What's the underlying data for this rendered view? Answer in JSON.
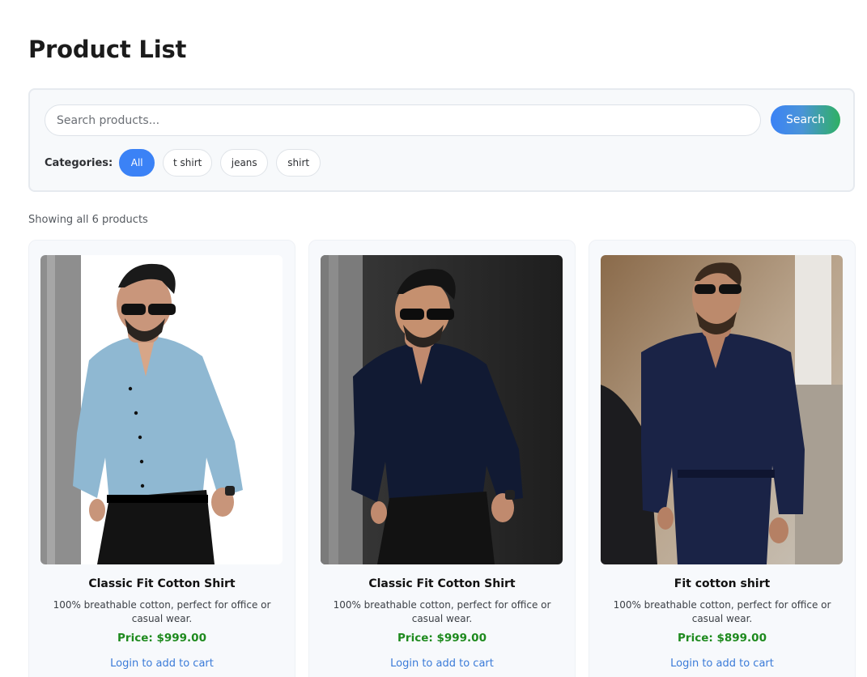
{
  "page": {
    "title": "Product List"
  },
  "search": {
    "placeholder": "Search products...",
    "button_label": "Search"
  },
  "categories": {
    "label": "Categories:",
    "items": [
      {
        "label": "All",
        "active": true
      },
      {
        "label": "t shirt",
        "active": false
      },
      {
        "label": "jeans",
        "active": false
      },
      {
        "label": "shirt",
        "active": false
      }
    ]
  },
  "results": {
    "count_text": "Showing all 6 products"
  },
  "products": [
    {
      "name": "Classic Fit Cotton Shirt",
      "description": "100% breathable cotton, perfect for office or casual wear.",
      "price": "Price: $999.00",
      "cta": "Login to add to cart",
      "image": "man-light-blue-shirt-photo"
    },
    {
      "name": "Classic Fit Cotton Shirt",
      "description": "100% breathable cotton, perfect for office or casual wear.",
      "price": "Price: $999.00",
      "cta": "Login to add to cart",
      "image": "man-navy-shirt-photo"
    },
    {
      "name": "Fit cotton shirt",
      "description": "100% breathable cotton, perfect for office or casual wear.",
      "price": "Price: $899.00",
      "cta": "Login to add to cart",
      "image": "man-navy-suit-street-photo"
    }
  ],
  "colors": {
    "accent": "#3b82f6",
    "price": "#1e8a1e",
    "link": "#3b7bd8",
    "panel": "#f7f9fb"
  }
}
